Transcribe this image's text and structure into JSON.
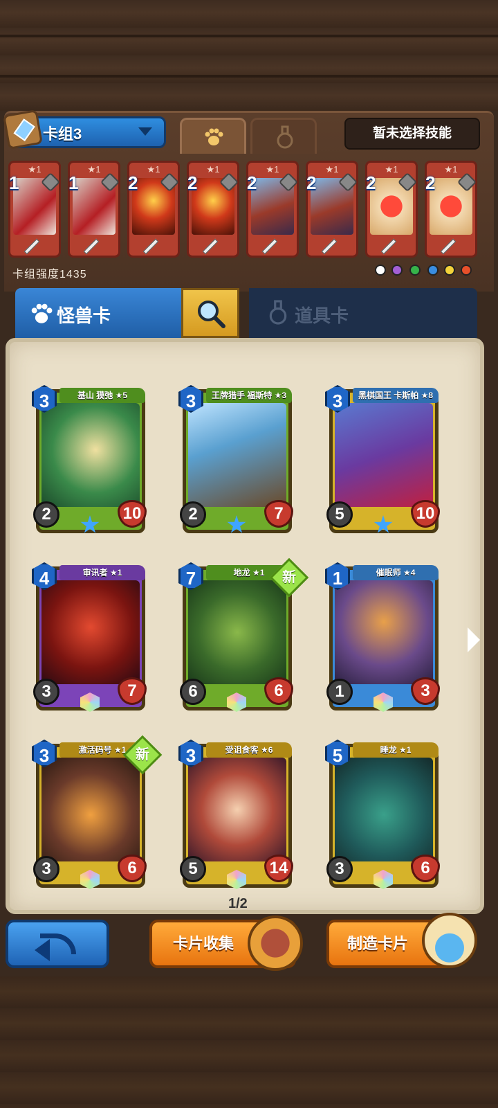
{
  "deck": {
    "name": "卡组3",
    "skill_button": "暂未选择技能",
    "power_label": "卡组强度1435",
    "cards": [
      {
        "cost": "1",
        "star": "★1"
      },
      {
        "cost": "1",
        "star": "★1"
      },
      {
        "cost": "2",
        "star": "★1"
      },
      {
        "cost": "2",
        "star": "★1"
      },
      {
        "cost": "2",
        "star": "★1"
      },
      {
        "cost": "2",
        "star": "★1"
      },
      {
        "cost": "2",
        "star": "★1"
      },
      {
        "cost": "2",
        "star": "★1"
      }
    ],
    "element_icons": [
      "neutral-icon",
      "void-icon",
      "nature-icon",
      "water-icon",
      "electric-icon",
      "fire-icon"
    ]
  },
  "tabs": {
    "monster_label": "怪兽卡",
    "item_label": "道具卡"
  },
  "collection": {
    "cards": [
      {
        "name": "基山 獏弛 ★5",
        "cost": "3",
        "atk": "2",
        "hp": "10",
        "skills": [
          "1",
          "1",
          "2",
          "2"
        ]
      },
      {
        "name": "王牌猎手 福斯特 ★3",
        "cost": "3",
        "atk": "2",
        "hp": "7",
        "skills": [
          "1",
          "1",
          "1"
        ]
      },
      {
        "name": "黑棋国王 卡斯帕 ★8",
        "cost": "3",
        "atk": "5",
        "hp": "10",
        "skills": [
          "1",
          "4",
          "4"
        ]
      },
      {
        "name": "审讯者 ★1",
        "cost": "4",
        "atk": "3",
        "hp": "7",
        "skills": [
          "1"
        ]
      },
      {
        "name": "地龙 ★1",
        "cost": "7",
        "atk": "6",
        "hp": "6",
        "skills": [
          "2"
        ],
        "badge": "新"
      },
      {
        "name": "催眠师 ★4",
        "cost": "1",
        "atk": "1",
        "hp": "3",
        "skills": [
          "2"
        ]
      },
      {
        "name": "激活码号 ★1",
        "cost": "3",
        "atk": "3",
        "hp": "6",
        "skills": [],
        "badge": "新"
      },
      {
        "name": "受诅食客 ★6",
        "cost": "3",
        "atk": "5",
        "hp": "14",
        "skills": [
          "1",
          "2"
        ]
      },
      {
        "name": "睡龙 ★1",
        "cost": "5",
        "atk": "3",
        "hp": "6",
        "skills": []
      }
    ],
    "page": "1/2"
  },
  "buttons": {
    "collect_label": "卡片收集",
    "craft_label": "制造卡片"
  },
  "colors": {
    "accent_blue": "#1f66c6",
    "button_orange": "#e8740f",
    "parchment": "#e9dfc8",
    "hp_red": "#c73a2e",
    "new_green": "#9be44a"
  }
}
